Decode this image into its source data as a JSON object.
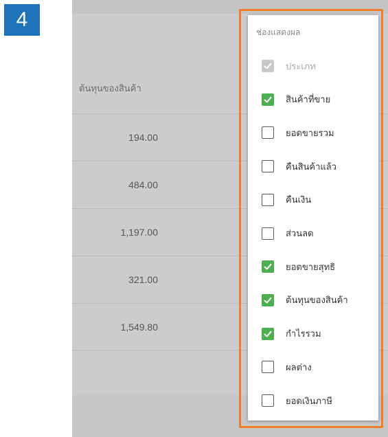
{
  "step_badge": "4",
  "report": {
    "column_header": "ต้นทุนของสินค้า",
    "values": [
      "194.00",
      "484.00",
      "1,197.00",
      "321.00",
      "1,549.80"
    ]
  },
  "columns_dropdown": {
    "title": "ช่องแสดงผล",
    "options": [
      {
        "label": "ประเภท",
        "checked": true,
        "disabled": true
      },
      {
        "label": "สินค้าที่ขาย",
        "checked": true,
        "disabled": false
      },
      {
        "label": "ยอดขายรวม",
        "checked": false,
        "disabled": false
      },
      {
        "label": "คืนสินค้าแล้ว",
        "checked": false,
        "disabled": false
      },
      {
        "label": "คืนเงิน",
        "checked": false,
        "disabled": false
      },
      {
        "label": "ส่วนลด",
        "checked": false,
        "disabled": false
      },
      {
        "label": "ยอดขายสุทธิ",
        "checked": true,
        "disabled": false
      },
      {
        "label": "ต้นทุนของสินค้า",
        "checked": true,
        "disabled": false
      },
      {
        "label": "กำไรรวม",
        "checked": true,
        "disabled": false
      },
      {
        "label": "ผลต่าง",
        "checked": false,
        "disabled": false
      },
      {
        "label": "ยอดเงินภาษี",
        "checked": false,
        "disabled": false
      }
    ]
  },
  "colors": {
    "badge": "#1d72b8",
    "highlight": "#ef7d2c",
    "checked": "#4caf50"
  }
}
